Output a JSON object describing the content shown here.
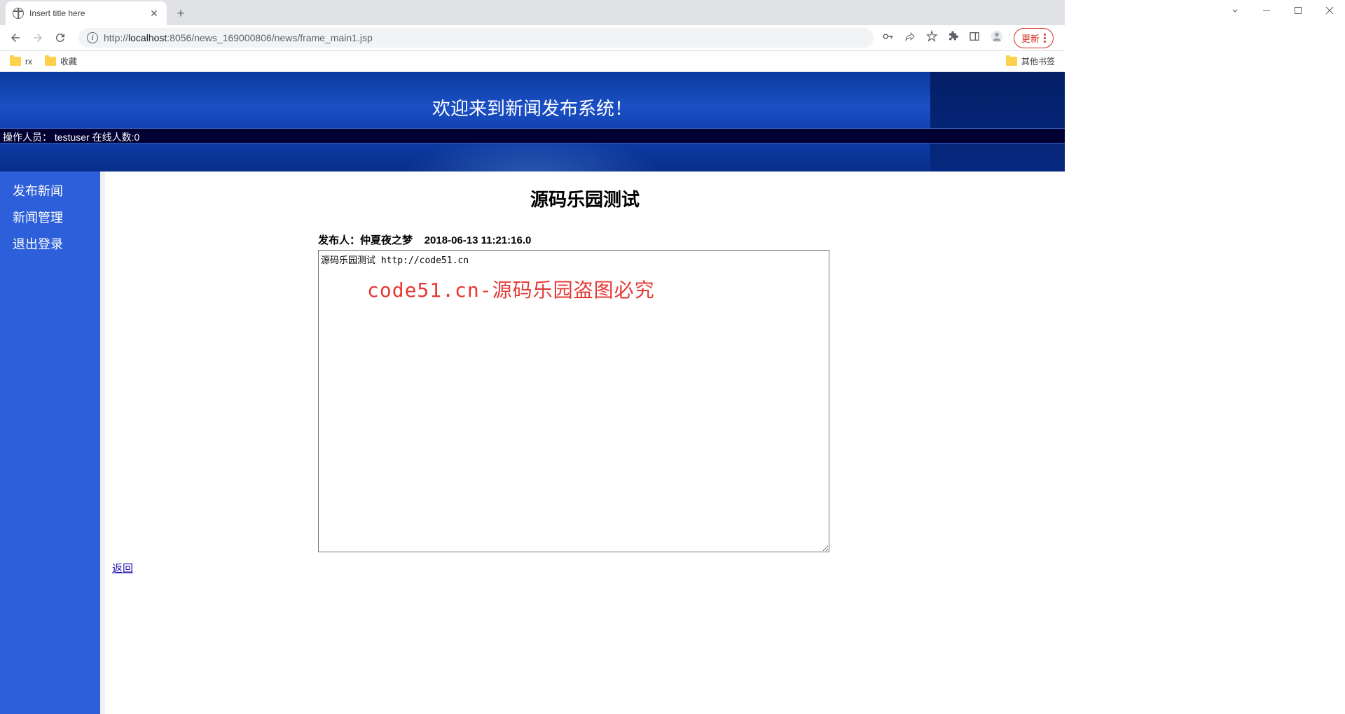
{
  "browser": {
    "tab_title": "Insert title here",
    "url_host": "localhost",
    "url_port": ":8056",
    "url_prefix": "http://",
    "url_path": "/news_169000806/news/frame_main1.jsp",
    "update_label": "更新"
  },
  "bookmarks": {
    "items": [
      "rx",
      "收藏"
    ],
    "other": "其他书签"
  },
  "header": {
    "title": "欢迎来到新闻发布系统！",
    "status_operator_label": "操作人员：",
    "status_operator_value": "testuser",
    "status_online_label": "在线人数:",
    "status_online_value": "0"
  },
  "sidebar": {
    "items": [
      {
        "label": "发布新闻"
      },
      {
        "label": "新闻管理"
      },
      {
        "label": "退出登录"
      }
    ]
  },
  "article": {
    "title": "源码乐园测试",
    "meta_publisher_label": "发布人：",
    "meta_publisher_value": "仲夏夜之梦",
    "meta_timestamp": "2018-06-13 11:21:16.0",
    "content": "源码乐园测试 http://code51.cn",
    "back_label": "返回"
  },
  "watermark": "code51.cn-源码乐园盗图必究"
}
